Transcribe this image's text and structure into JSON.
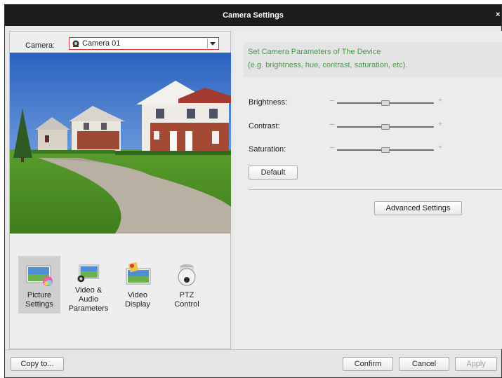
{
  "window": {
    "title": "Camera Settings",
    "close_glyph": "×"
  },
  "camera": {
    "label": "Camera:",
    "selected": "Camera 01",
    "icon": "camera-icon",
    "dropdown_icon": "chevron-down-icon"
  },
  "tabs": [
    {
      "line1": "Picture",
      "line2": "Settings",
      "icon": "picture-settings-icon",
      "active": true
    },
    {
      "line1": "Video & Audio",
      "line2": "Parameters",
      "icon": "video-audio-icon",
      "active": false
    },
    {
      "line1": "Video",
      "line2": "Display",
      "icon": "video-display-icon",
      "active": false
    },
    {
      "line1": "PTZ",
      "line2": "Control",
      "icon": "ptz-dome-camera-icon",
      "active": false
    }
  ],
  "info": {
    "line1": "Set Camera Parameters of The Device",
    "line2": "(e.g. brightness, hue, contrast, saturation, etc)."
  },
  "sliders": [
    {
      "label": "Brightness:",
      "value": 0.5
    },
    {
      "label": "Contrast:",
      "value": 0.5
    },
    {
      "label": "Saturation:",
      "value": 0.5
    }
  ],
  "slider_minus": "–",
  "slider_plus": "+",
  "buttons": {
    "default": "Default",
    "advanced": "Advanced Settings",
    "copy_to": "Copy to...",
    "confirm": "Confirm",
    "cancel": "Cancel",
    "apply": "Apply"
  },
  "colors": {
    "titlebar": "#1c1c1c",
    "info_text": "#4a9a4a",
    "select_border": "#d0323a"
  }
}
